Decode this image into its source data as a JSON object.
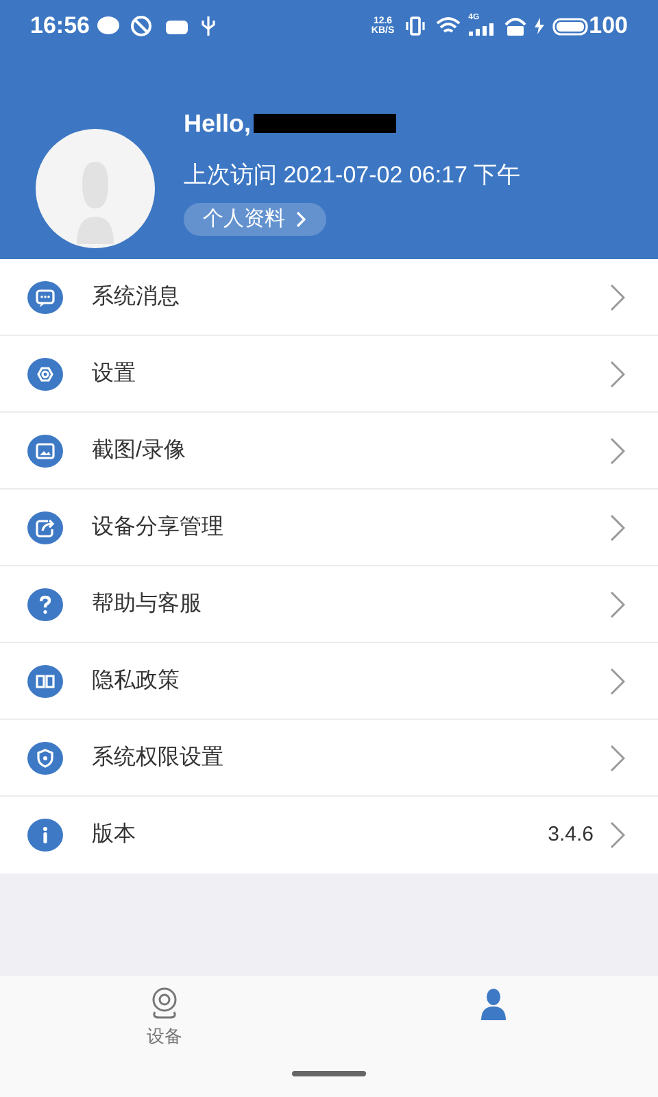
{
  "status_bar": {
    "time": "16:56",
    "net_speed_value": "12.6",
    "net_speed_unit": "KB/S",
    "signal_type": "4G",
    "battery": "100"
  },
  "profile": {
    "greeting": "Hello,",
    "name_redacted": true,
    "last_visit": "上次访问 2021-07-02 06:17 下午",
    "profile_button": "个人资料"
  },
  "menu": [
    {
      "kind": "message",
      "label": "系统消息"
    },
    {
      "kind": "settings",
      "label": "设置"
    },
    {
      "kind": "image",
      "label": "截图/录像"
    },
    {
      "kind": "share",
      "label": "设备分享管理"
    },
    {
      "kind": "help",
      "label": "帮助与客服"
    },
    {
      "kind": "book",
      "label": "隐私政策"
    },
    {
      "kind": "shield",
      "label": "系统权限设置"
    },
    {
      "kind": "info",
      "label": "版本",
      "value": "3.4.6"
    }
  ],
  "tabs": [
    {
      "kind": "camera",
      "label": "设备",
      "selected": false
    },
    {
      "kind": "person",
      "selected": true
    }
  ]
}
